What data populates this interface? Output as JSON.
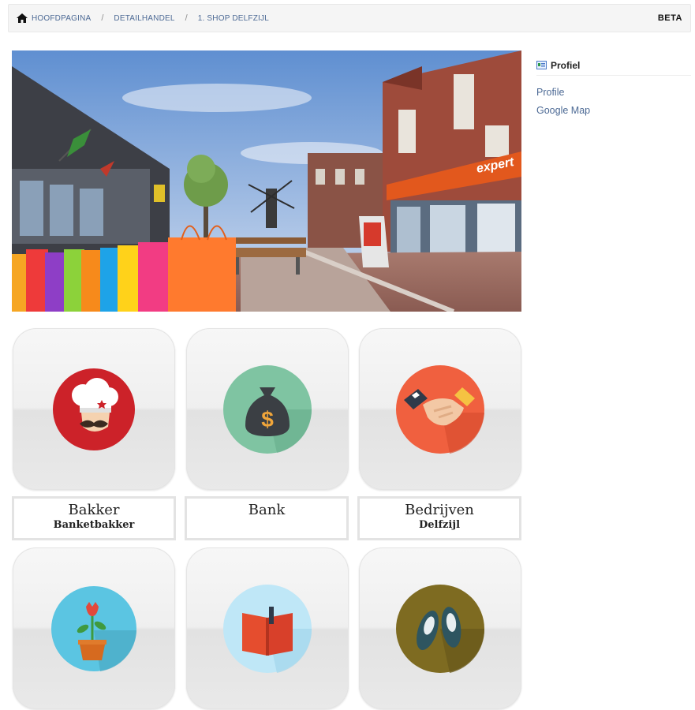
{
  "breadcrumb": {
    "items": [
      "HOOFDPAGINA",
      "DETAILHANDEL",
      "1. SHOP DELFZIJL"
    ],
    "separator": "/",
    "badge": "BETA"
  },
  "hero": {
    "shop_sign": "expert",
    "icon": "shopping-street-photo"
  },
  "sidebar": {
    "heading": "Profiel",
    "links": [
      "Profile",
      "Google Map"
    ]
  },
  "tiles": [
    {
      "title": "Bakker",
      "subtitle": "Banketbakker",
      "icon": "chef-icon",
      "color": "#cc2229"
    },
    {
      "title": "Bank",
      "subtitle": "",
      "icon": "money-bag-icon",
      "color": "#7fc4a2"
    },
    {
      "title": "Bedrijven",
      "subtitle": "Delfzijl",
      "icon": "handshake-icon",
      "color": "#f0603f"
    },
    {
      "title": "",
      "subtitle": "",
      "icon": "flower-pot-icon",
      "color": "#5bc5e2"
    },
    {
      "title": "",
      "subtitle": "",
      "icon": "book-icon",
      "color": "#bfe7f7"
    },
    {
      "title": "",
      "subtitle": "",
      "icon": "ballet-shoes-icon",
      "color": "#7e6b21"
    }
  ],
  "colors": {
    "link": "#4d6a95",
    "crumb_bg": "#f5f5f5",
    "tile_bg": "#efefef"
  }
}
